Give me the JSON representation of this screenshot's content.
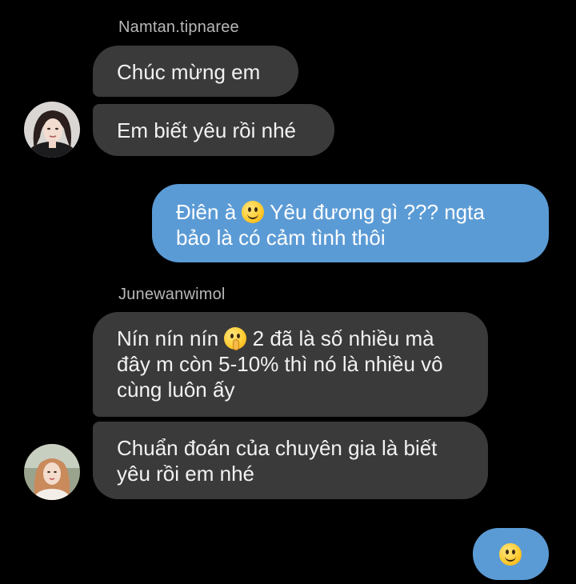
{
  "thread": {
    "group1": {
      "sender": "Namtan.tipnaree",
      "messages": [
        {
          "text": "Chúc mừng em"
        },
        {
          "text": "Em biết yêu rồi nhé"
        }
      ]
    },
    "outgoing1": {
      "part1": "Điên à ",
      "part2": " Yêu đương gì ??? ngta\nbảo là có cảm tình thôi",
      "emoji": "slightly-smiling-face"
    },
    "group2": {
      "sender": "Junewanwimol",
      "messages": [
        {
          "part1": "Nín nín nín ",
          "part2": " 2 đã là số nhiều mà\nđây m còn 5-10% thì nó là nhiều vô\ncùng luôn ấy",
          "emoji": "shushing-face"
        },
        {
          "text": "Chuẩn đoán của chuyên gia là biết\nyêu rồi em nhé"
        }
      ]
    },
    "outgoing2": {
      "emoji": "slightly-smiling-face"
    }
  },
  "colors": {
    "background": "#000000",
    "incoming_bubble": "#3a3a3a",
    "outgoing_bubble": "#5b9bd5",
    "sender_name": "#b8b8b8"
  }
}
